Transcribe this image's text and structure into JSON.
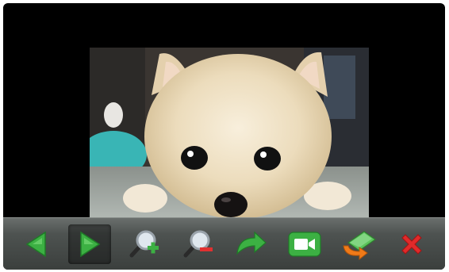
{
  "viewer": {
    "photo_subject": "",
    "toolbar": {
      "buttons": [
        {
          "name": "previous",
          "icon": "arrow-left-icon",
          "color": "#3cb043"
        },
        {
          "name": "play-slideshow",
          "icon": "play-icon",
          "color": "#3cb043",
          "active": true
        },
        {
          "name": "zoom-in",
          "icon": "zoom-in-icon",
          "color": "#3cb043"
        },
        {
          "name": "zoom-out",
          "icon": "zoom-out-icon",
          "color": "#e03030"
        },
        {
          "name": "rotate",
          "icon": "rotate-icon",
          "color": "#3cb043"
        },
        {
          "name": "video",
          "icon": "video-camera-icon",
          "color": "#3cb043"
        },
        {
          "name": "set-as-wallpaper",
          "icon": "image-swap-icon",
          "color": "#f07a18"
        },
        {
          "name": "close",
          "icon": "close-icon",
          "color": "#e02a2a"
        }
      ]
    }
  }
}
